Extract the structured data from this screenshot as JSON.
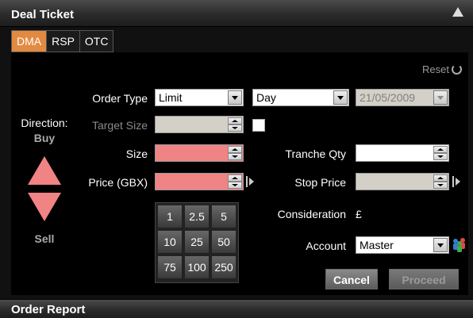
{
  "window": {
    "title": "Deal Ticket"
  },
  "tabs": [
    {
      "label": "DMA",
      "active": true
    },
    {
      "label": "RSP",
      "active": false
    },
    {
      "label": "OTC",
      "active": false
    }
  ],
  "reset_label": "Reset",
  "direction": {
    "label": "Direction:",
    "buy": "Buy",
    "sell": "Sell"
  },
  "fields": {
    "order_type": {
      "label": "Order Type",
      "value": "Limit"
    },
    "duration": {
      "value": "Day"
    },
    "date": {
      "value": "21/05/2009"
    },
    "target_size": {
      "label": "Target Size",
      "value": ""
    },
    "size": {
      "label": "Size",
      "value": ""
    },
    "price": {
      "label": "Price (GBX)",
      "value": ""
    },
    "tranche_qty": {
      "label": "Tranche Qty",
      "value": ""
    },
    "stop_price": {
      "label": "Stop Price",
      "value": ""
    },
    "consideration": {
      "label": "Consideration",
      "value": "£"
    },
    "account": {
      "label": "Account",
      "value": "Master"
    }
  },
  "keypad": [
    "1",
    "2.5",
    "5",
    "10",
    "25",
    "50",
    "75",
    "100",
    "250"
  ],
  "buttons": {
    "cancel": "Cancel",
    "proceed": "Proceed"
  },
  "footer": {
    "title": "Order Report"
  },
  "colors": {
    "accent": "#e38a42",
    "required": "#f08383"
  }
}
